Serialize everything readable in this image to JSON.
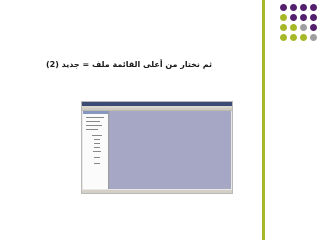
{
  "slide": {
    "title": "ثم نختار من أعلى القائمة ملف = جديد (2)",
    "accent_bar_color": "#a6b728",
    "decor_dot_colors": [
      "#53206d",
      "#a6b728",
      "#9e9ea0"
    ]
  },
  "screenshot": {
    "description_icon": "application-window-screenshot",
    "canvas_color": "#a5a7c4",
    "titlebar_color": "#3c4a76"
  }
}
